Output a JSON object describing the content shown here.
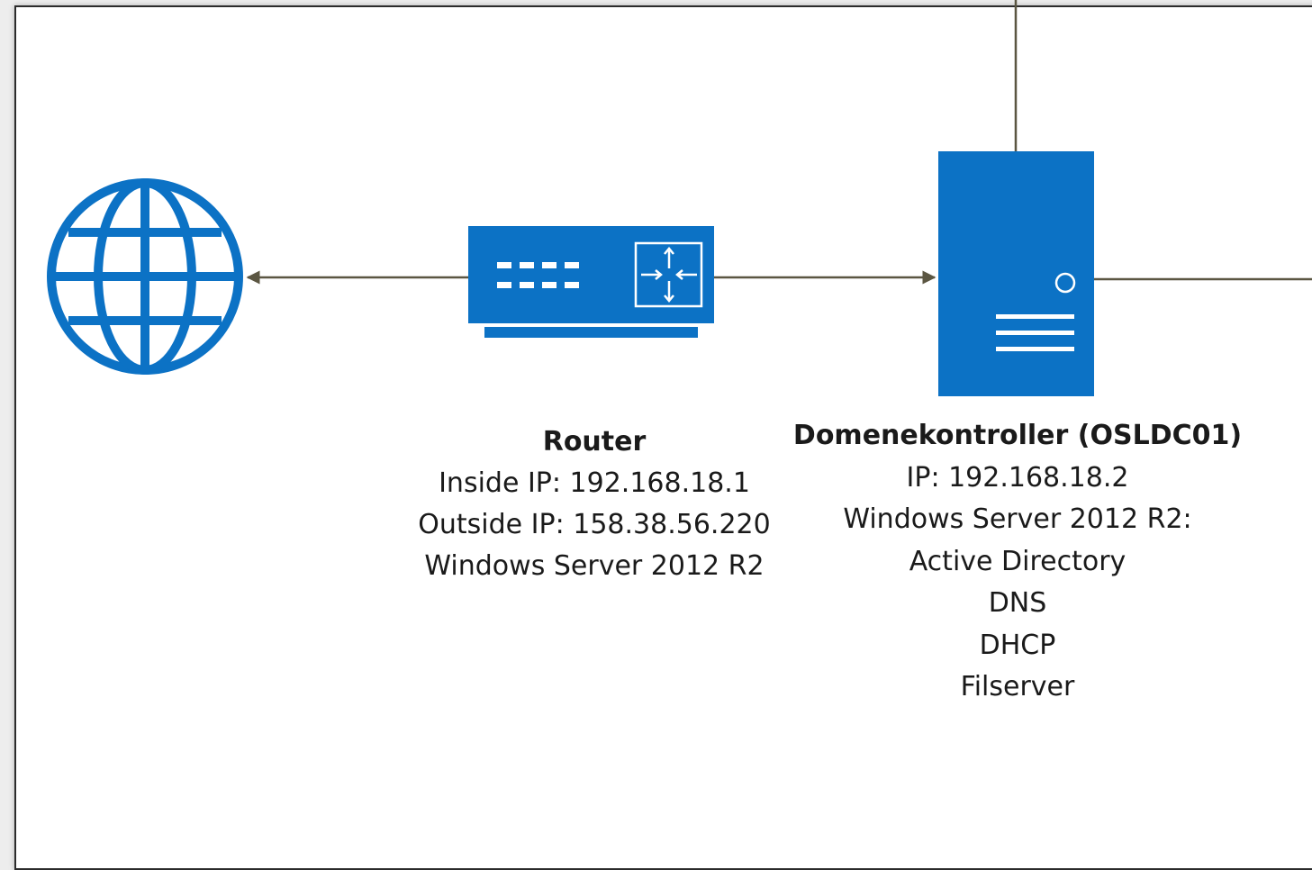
{
  "colors": {
    "icon_blue": "#0c72c5",
    "connector": "#5b5642",
    "background": "#ffffff",
    "frame": "#2b2b2b"
  },
  "icons": {
    "internet": "globe-icon",
    "router": "router-icon",
    "domain_controller": "server-tower-icon"
  },
  "router": {
    "title": "Router",
    "lines": [
      "Inside IP: 192.168.18.1",
      "Outside IP: 158.38.56.220",
      "Windows Server 2012 R2"
    ]
  },
  "domain_controller": {
    "title": "Domenekontroller (OSLDC01)",
    "lines": [
      "IP: 192.168.18.2",
      "Windows Server 2012 R2:",
      "Active Directory",
      "DNS",
      "DHCP",
      "Filserver"
    ]
  }
}
